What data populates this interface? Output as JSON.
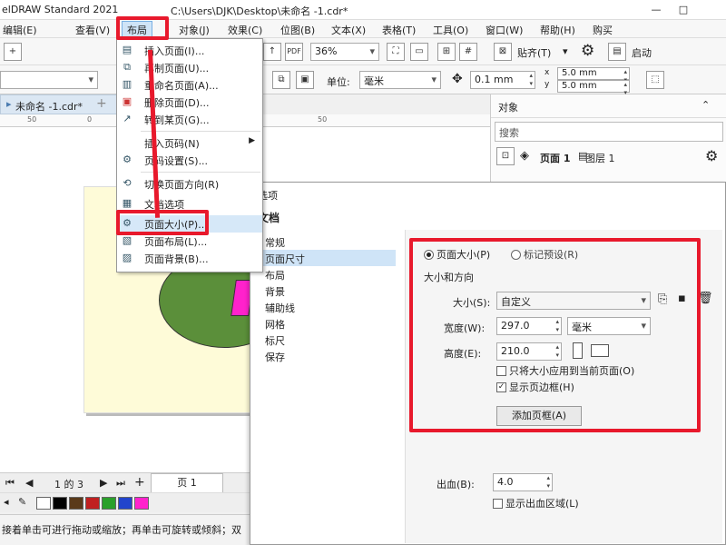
{
  "titlebar": {
    "app_title": "elDRAW Standard 2021",
    "file_path": "C:\\Users\\DJK\\Desktop\\未命名 -1.cdr*",
    "minimize": "—",
    "restore": "□"
  },
  "menubar": {
    "items": [
      "编辑(E)",
      "查看(V)",
      "布局",
      "对象(J)",
      "效果(C)",
      "位图(B)",
      "文本(X)",
      "表格(T)",
      "工具(O)",
      "窗口(W)",
      "帮助(H)",
      "购买"
    ]
  },
  "toolbar1": {
    "zoom": "36%",
    "snap_label": "贴齐(T)",
    "launch_label": "启动"
  },
  "toolbar2": {
    "unit_label": "单位:",
    "unit_value": "毫米",
    "nudge": "0.1 mm",
    "dup_x": "5.0 mm",
    "dup_y": "5.0 mm"
  },
  "document": {
    "tab_name": "未命名 -1.cdr*",
    "ruler_marks": [
      "50",
      "0",
      "50"
    ]
  },
  "page_nav": {
    "counter": "1 的 3",
    "page_tab": "页 1"
  },
  "palette": {
    "colors": [
      "#000000",
      "#5a3a1a",
      "#c02020",
      "#2aa02a",
      "#2244cc",
      "#ff22cc",
      "#7a2a9a"
    ]
  },
  "status": {
    "text": "接着单击可进行拖动或缩放；再单击可旋转或倾斜；双"
  },
  "objects_panel": {
    "title": "对象",
    "search_placeholder": "搜索",
    "page_label": "页面 1",
    "layer_label": "图层 1"
  },
  "layout_menu": {
    "title": "布局",
    "items": [
      {
        "label": "插入页面(I)...",
        "icon": "insert-page"
      },
      {
        "label": "再制页面(U)...",
        "icon": "duplicate-page"
      },
      {
        "label": "重命名页面(A)...",
        "icon": "rename-page"
      },
      {
        "label": "删除页面(D)...",
        "icon": "delete-page"
      },
      {
        "label": "转到某页(G)...",
        "icon": "goto-page"
      },
      {
        "label": "插入页码(N)",
        "icon": "",
        "submenu": true
      },
      {
        "label": "页码设置(S)...",
        "icon": "page-number-settings"
      },
      {
        "label": "切换页面方向(R)",
        "icon": "switch-orientation"
      },
      {
        "label": "文档选项",
        "icon": "document-options"
      },
      {
        "label": "页面大小(P)...",
        "icon": "page-size",
        "selected": true
      },
      {
        "label": "页面布局(L)...",
        "icon": "page-layout"
      },
      {
        "label": "页面背景(B)...",
        "icon": "page-background"
      }
    ]
  },
  "options_dialog": {
    "title": "选项",
    "section": "文档",
    "tree": [
      "常规",
      "页面尺寸",
      "布局",
      "背景",
      "辅助线",
      "网格",
      "标尺",
      "保存"
    ],
    "selected_tree": "页面尺寸",
    "radio_page_size": "页面大小(P)",
    "radio_preset": "标记预设(R)",
    "group_label": "大小和方向",
    "size_label": "大小(S):",
    "size_value": "自定义",
    "width_label": "宽度(W):",
    "width_value": "297.0",
    "width_unit": "毫米",
    "height_label": "高度(E):",
    "height_value": "210.0",
    "apply_current_only": "只将大小应用到当前页面(O)",
    "show_page_border": "显示页边框(H)",
    "add_frame_button": "添加页框(A)",
    "bleed_label": "出血(B):",
    "bleed_value": "4.0",
    "show_bleed": "显示出血区域(L)"
  }
}
